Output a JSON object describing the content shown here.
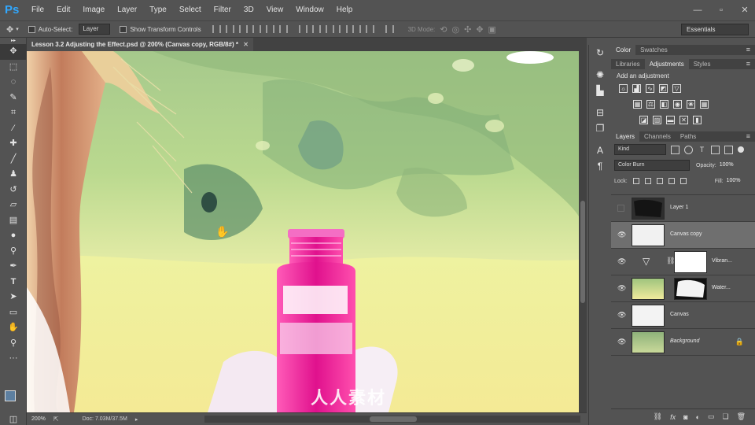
{
  "app": {
    "logo": "Ps"
  },
  "menu": [
    "File",
    "Edit",
    "Image",
    "Layer",
    "Type",
    "Select",
    "Filter",
    "3D",
    "View",
    "Window",
    "Help"
  ],
  "window_controls": [
    "minimize-icon",
    "maximize-icon",
    "close-icon"
  ],
  "options": {
    "auto_select_label": "Auto-Select:",
    "auto_select_value": "Layer",
    "show_transform_label": "Show Transform Controls",
    "mode_3d_label": "3D Mode:",
    "workspace": "Essentials"
  },
  "document": {
    "tab_title": "Lesson 3.2 Adjusting the Effect.psd @ 200% (Canvas copy, RGB/8#) *"
  },
  "status": {
    "zoom": "200%",
    "doc_size": "Doc: 7.03M/37.5M"
  },
  "panels": {
    "color_tabs": [
      "Color",
      "Swatches"
    ],
    "adjust_tabs": [
      "Libraries",
      "Adjustments",
      "Styles"
    ],
    "adjust_title": "Add an adjustment",
    "layers_tabs": [
      "Layers",
      "Channels",
      "Paths"
    ],
    "kind_filter": "Kind",
    "blend_mode": "Color Burn",
    "opacity_label": "Opacity:",
    "opacity_value": "100%",
    "lock_label": "Lock:",
    "fill_label": "Fill:",
    "fill_value": "100%"
  },
  "layers": [
    {
      "name": "Layer 1",
      "visible": false,
      "selected": false
    },
    {
      "name": "Canvas copy",
      "visible": true,
      "selected": true
    },
    {
      "name": "Vibran...",
      "visible": true,
      "selected": false
    },
    {
      "name": "Water...",
      "visible": true,
      "selected": false
    },
    {
      "name": "Canvas",
      "visible": true,
      "selected": false
    },
    {
      "name": "Background",
      "visible": true,
      "selected": false,
      "locked": true
    }
  ],
  "watermark": "人人素材",
  "colors": {
    "accent": "#31a8ff",
    "foreground": "#5d7fa0",
    "background_swatch": "#ffffff"
  }
}
